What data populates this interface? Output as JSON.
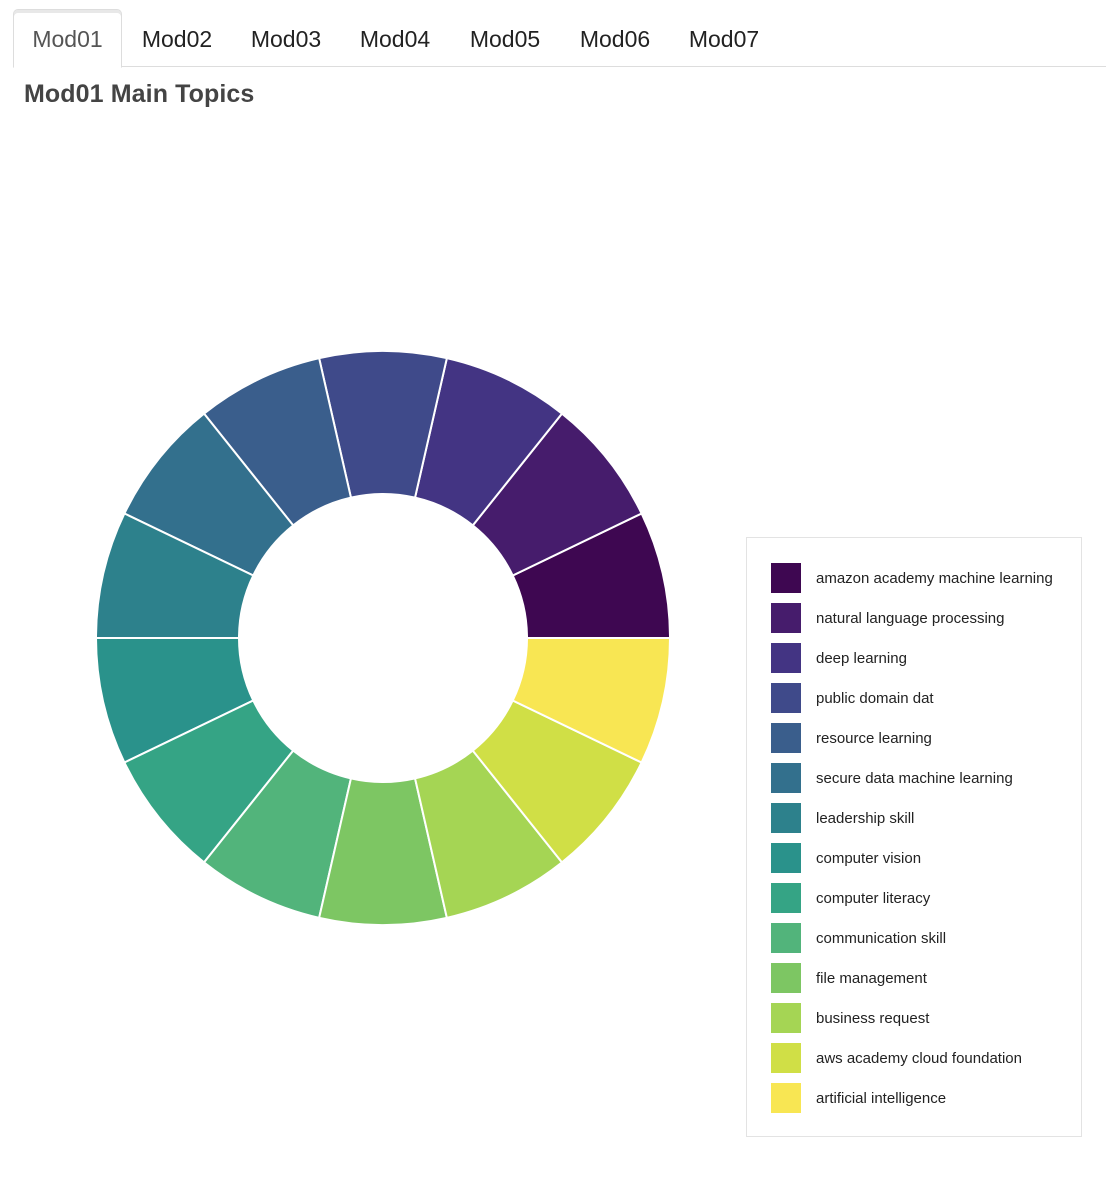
{
  "tabs": [
    {
      "label": "Mod01",
      "active": true
    },
    {
      "label": "Mod02",
      "active": false
    },
    {
      "label": "Mod03",
      "active": false
    },
    {
      "label": "Mod04",
      "active": false
    },
    {
      "label": "Mod05",
      "active": false
    },
    {
      "label": "Mod06",
      "active": false
    },
    {
      "label": "Mod07",
      "active": false
    }
  ],
  "chart_data": {
    "type": "pie",
    "title": "Mod01 Main Topics",
    "donut": true,
    "legend_position": "right",
    "categories": [
      "amazon academy machine learning",
      "natural language processing",
      "deep learning",
      "public domain dat",
      "resource learning",
      "secure data machine learning",
      "leadership skill",
      "computer vision",
      "computer literacy",
      "communication skill",
      "file management",
      "business request",
      "aws academy cloud foundation",
      "artificial intelligence"
    ],
    "values": [
      1,
      1,
      1,
      1,
      1,
      1,
      1,
      1,
      1,
      1,
      1,
      1,
      1,
      1
    ],
    "colors": [
      "#3e0751",
      "#461c6c",
      "#433483",
      "#3f4a8a",
      "#3a5e8c",
      "#33708d",
      "#2d818c",
      "#2a928b",
      "#35a485",
      "#52b47b",
      "#7dc663",
      "#a5d554",
      "#d0df46",
      "#f8e653"
    ]
  }
}
